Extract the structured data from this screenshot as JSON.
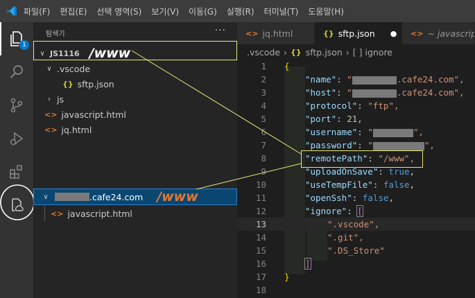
{
  "menu": [
    "파일(F)",
    "편집(E)",
    "선택 영역(S)",
    "보기(V)",
    "이동(G)",
    "실행(R)",
    "터미널(T)",
    "도움말(H)"
  ],
  "activity": {
    "badge": "1"
  },
  "sidebar": {
    "title": "탐색기",
    "more": "···",
    "root": "JS1116",
    "annotation": "/www",
    "items": [
      ".vscode",
      "sftp.json",
      "js",
      "javascript.html",
      "jq.html"
    ],
    "remote": {
      "host_suffix": ".cafe24.com",
      "annotation": "/www",
      "child": "javascript.html"
    }
  },
  "tabs": [
    {
      "label": "jq.html"
    },
    {
      "label": "sftp.json",
      "modified": "●"
    },
    {
      "label": "~ javascript.htm"
    }
  ],
  "breadcrumb": {
    "folder": ".vscode",
    "sep1": "›",
    "file": "sftp.json",
    "sep2": "›",
    "node": "[ ] ignore"
  },
  "code": {
    "open": "{",
    "close": "}",
    "name_key": "\"name\"",
    "name_val": ".cafe24.com\",",
    "host_key": "\"host\"",
    "host_val": ".cafe24.com\",",
    "protocol_key": "\"protocol\"",
    "protocol_val": "\"ftp\",",
    "port_key": "\"port\"",
    "port_val": "21",
    "username_key": "\"username\"",
    "password_key": "\"password\"",
    "remote_key": "\"remotePath\"",
    "remote_val": "\"/www\",",
    "upload_key": "\"uploadOnSave\"",
    "upload_val": "true",
    "temp_key": "\"useTempFile\"",
    "temp_val": "false",
    "ssh_key": "\"openSsh\"",
    "ssh_val": "false",
    "ignore_key": "\"ignore\"",
    "arr_open": "[",
    "arr_close": "]",
    "ig1": "\".vscode\",",
    "ig2": "\".git\",",
    "ig3": "\".DS_Store\""
  },
  "line_numbers": [
    "1",
    "2",
    "3",
    "4",
    "5",
    "6",
    "7",
    "8",
    "9",
    "10",
    "11",
    "12",
    "13",
    "14",
    "15",
    "16",
    "17",
    "18"
  ],
  "current_line": "13"
}
